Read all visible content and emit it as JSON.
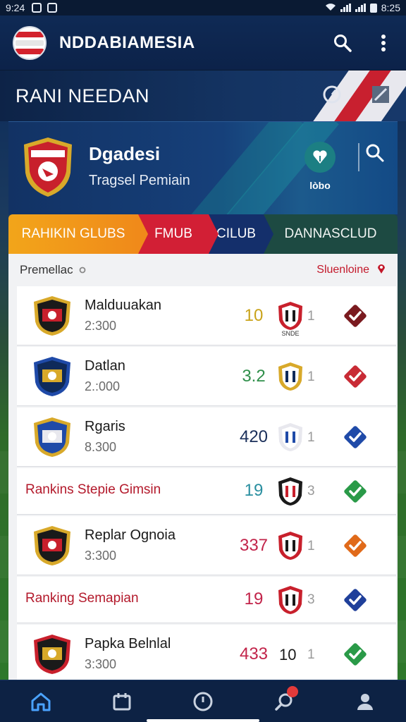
{
  "status_bar": {
    "time": "9:24",
    "right_time": "8:25"
  },
  "app_bar": {
    "title": "NDDABIAMESIA",
    "search_icon": "search-icon",
    "menu_icon": "more-vert-icon"
  },
  "section": {
    "title": "RANI NEEDAN"
  },
  "featured": {
    "title": "Dgadesi",
    "subtitle": "Tragsel Pemiain",
    "vote_label": "lòbo"
  },
  "tabs": [
    {
      "label": "RAHIKIN GLUBS"
    },
    {
      "label": "FMUB"
    },
    {
      "label": "CILUB"
    },
    {
      "label": "DANNASCLUD"
    }
  ],
  "list": {
    "left_label": "Premellac",
    "right_label": "Sluenloine",
    "rows": [
      {
        "kind": "club",
        "name": "Malduuakan",
        "sub": "2:300",
        "score": "10",
        "score_color": "#c9a31a",
        "mini_label": "SNDE",
        "count": "1",
        "badge_color": "#7a1a1f"
      },
      {
        "kind": "club",
        "name": "Datlan",
        "sub": "2.:000",
        "score": "3.2",
        "score_color": "#2f8f4a",
        "count": "1",
        "badge_color": "#c82b35"
      },
      {
        "kind": "club",
        "name": "Rgaris",
        "sub": "8.300",
        "score": "420",
        "score_color": "#1a2f5a",
        "count": "1",
        "badge_color": "#1f4aa8"
      },
      {
        "kind": "banner",
        "name": "Rankins Stepie Gimsin",
        "score": "19",
        "score_color": "#2a8fa0",
        "count": "3",
        "badge_color": "#2a9a48"
      },
      {
        "kind": "club",
        "name": "Replar Ognoia",
        "sub": "3:300",
        "score": "337",
        "score_color": "#c2244a",
        "count": "1",
        "badge_color": "#e06a1a"
      },
      {
        "kind": "banner",
        "name": "Ranking Semapian",
        "score": "19",
        "score_color": "#c2244a",
        "count": "3",
        "badge_color": "#1f3f9a"
      },
      {
        "kind": "club",
        "name": "Papka Belnlal",
        "sub": "3:300",
        "score": "433",
        "score_color": "#c2244a",
        "extra": "10",
        "count": "1",
        "badge_color": "#2a9a48"
      }
    ]
  },
  "bottom_nav": [
    {
      "icon": "home-icon",
      "color": "#4aa3ff"
    },
    {
      "icon": "calendar-icon",
      "color": "#c9d2e0"
    },
    {
      "icon": "compass-icon",
      "color": "#c9d2e0"
    },
    {
      "icon": "search-icon",
      "color": "#c9d2e0"
    },
    {
      "icon": "profile-icon",
      "color": "#c9d2e0"
    }
  ]
}
